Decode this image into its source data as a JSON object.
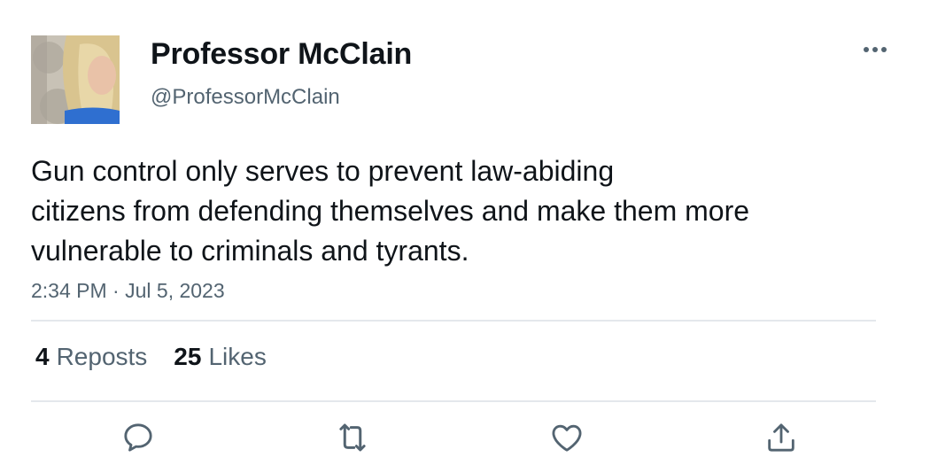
{
  "user": {
    "display_name": "Professor McClain",
    "handle": "@ProfessorMcClain",
    "avatar": "profile-photo"
  },
  "tweet": {
    "text_lines": [
      "Gun control only serves to prevent law-abiding",
      "citizens from defending themselves and make them more",
      "vulnerable to criminals and tyrants."
    ],
    "time": "2:34 PM",
    "separator": "·",
    "date": "Jul 5, 2023"
  },
  "stats": {
    "reposts_count": "4",
    "reposts_label": "Reposts",
    "likes_count": "25",
    "likes_label": "Likes"
  },
  "icons": {
    "more": "more-horizontal-icon",
    "reply": "reply-icon",
    "repost": "repost-icon",
    "like": "heart-icon",
    "share": "share-icon"
  },
  "colors": {
    "text_primary": "#0f1419",
    "text_secondary": "#536471",
    "divider": "#e4e8ec",
    "icon": "#536471"
  }
}
